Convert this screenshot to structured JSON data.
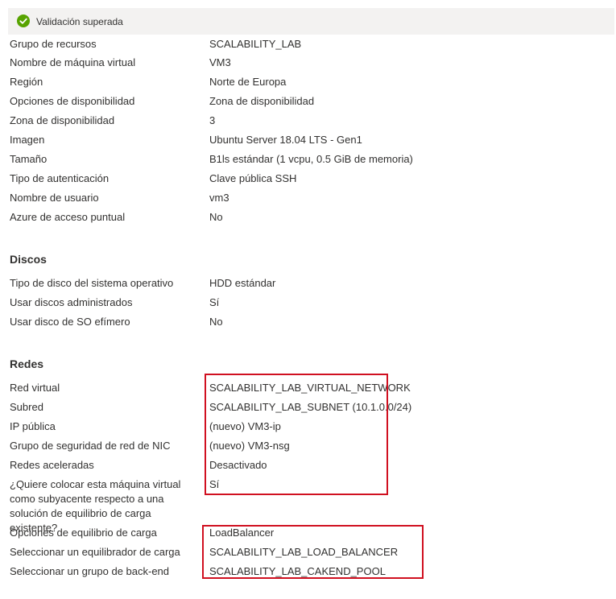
{
  "banner": {
    "text": "Validación superada",
    "icon": "check-circle-icon",
    "color": "#57a300"
  },
  "basics": [
    {
      "label": "Grupo de recursos",
      "value": "SCALABILITY_LAB"
    },
    {
      "label": "Nombre de máquina virtual",
      "value": "VM3"
    },
    {
      "label": "Región",
      "value": "Norte de Europa"
    },
    {
      "label": "Opciones de disponibilidad",
      "value": "Zona de disponibilidad"
    },
    {
      "label": "Zona de disponibilidad",
      "value": "3"
    },
    {
      "label": "Imagen",
      "value": "Ubuntu Server 18.04 LTS - Gen1"
    },
    {
      "label": "Tamaño",
      "value": "B1ls estándar (1 vcpu, 0.5 GiB de memoria)"
    },
    {
      "label": "Tipo de autenticación",
      "value": "Clave pública SSH"
    },
    {
      "label": "Nombre de usuario",
      "value": "vm3"
    },
    {
      "label": "Azure de acceso puntual",
      "value": "No"
    }
  ],
  "disks": {
    "title": "Discos",
    "rows": [
      {
        "label": "Tipo de disco del sistema operativo",
        "value": "HDD estándar"
      },
      {
        "label": "Usar discos administrados",
        "value": "Sí"
      },
      {
        "label": "Usar disco de SO efímero",
        "value": "No"
      }
    ]
  },
  "network": {
    "title": "Redes",
    "rows": [
      {
        "label": "Red virtual",
        "value": "SCALABILITY_LAB_VIRTUAL_NETWORK"
      },
      {
        "label": "Subred",
        "value": "SCALABILITY_LAB_SUBNET (10.1.0.0/24)"
      },
      {
        "label": "IP pública",
        "value": "(nuevo) VM3-ip"
      },
      {
        "label": "Grupo de seguridad de red de NIC",
        "value": "(nuevo) VM3-nsg"
      },
      {
        "label": "Redes aceleradas",
        "value": "Desactivado"
      },
      {
        "label": "¿Quiere colocar esta máquina virtual como subyacente respecto a una solución de equilibrio de carga existente?",
        "value": "Sí"
      },
      {
        "label": "Opciones de equilibrio de carga",
        "value": "LoadBalancer"
      },
      {
        "label": "Seleccionar un equilibrador de carga",
        "value": "SCALABILITY_LAB_LOAD_BALANCER"
      },
      {
        "label": "Seleccionar un grupo de back-end",
        "value": "SCALABILITY_LAB_CAKEND_POOL"
      }
    ]
  },
  "highlight_color": "#d01020"
}
